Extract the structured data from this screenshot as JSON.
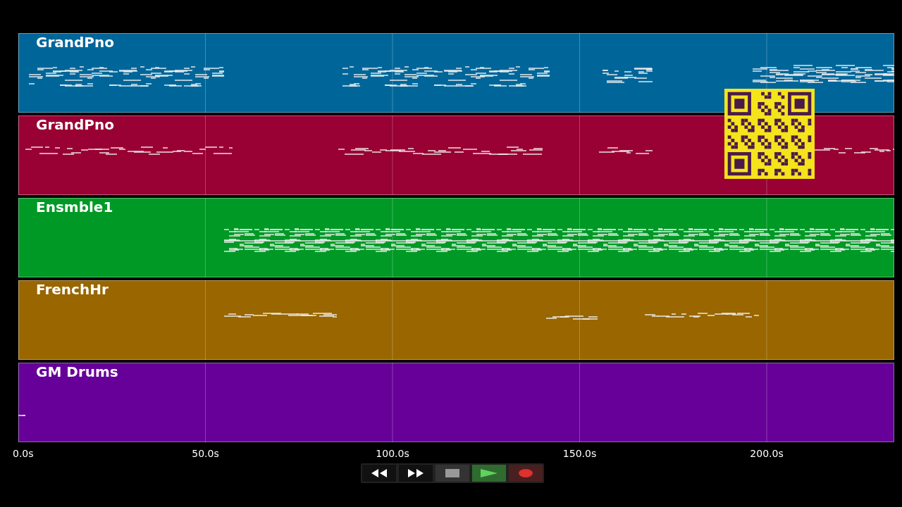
{
  "tracks": [
    {
      "name": "GrandPno",
      "color": "#006699"
    },
    {
      "name": "GrandPno",
      "color": "#990033"
    },
    {
      "name": "Ensmble1",
      "color": "#009926"
    },
    {
      "name": "FrenchHr",
      "color": "#996600"
    },
    {
      "name": "GM Drums",
      "color": "#660099"
    }
  ],
  "time_axis": {
    "ticks": [
      "0.0s",
      "50.0s",
      "100.0s",
      "150.0s",
      "200.0s"
    ]
  },
  "transport": [
    {
      "kind": "rewind"
    },
    {
      "kind": "forward"
    },
    {
      "kind": "stop"
    },
    {
      "kind": "play"
    },
    {
      "kind": "record"
    }
  ]
}
